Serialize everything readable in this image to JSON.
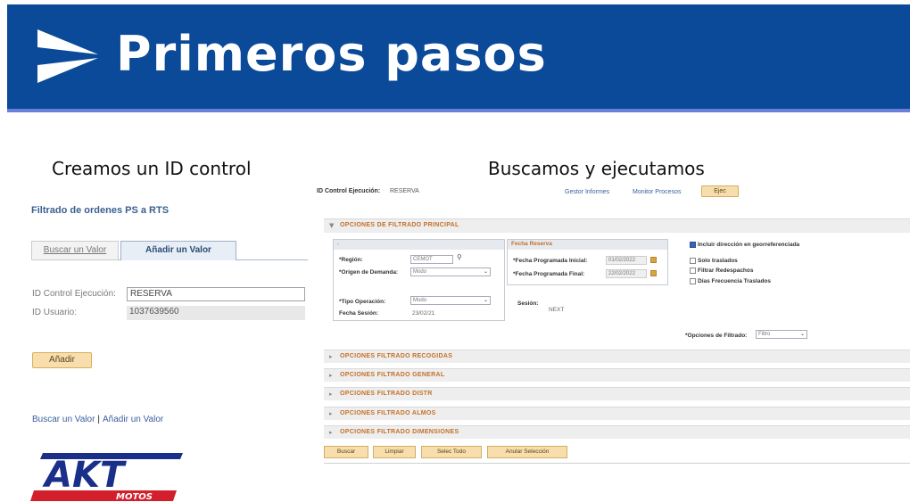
{
  "banner": {
    "title": "Primeros pasos",
    "background": "#0b4a98",
    "icon": "chevron-logo-icon"
  },
  "left_section": {
    "heading": "Creamos un ID control",
    "page_title": "Filtrado de ordenes PS a RTS",
    "tabs": [
      {
        "label": "Buscar un Valor",
        "active": false
      },
      {
        "label": "Añadir un Valor",
        "active": true
      }
    ],
    "fields": {
      "control_label": "ID Control Ejecución:",
      "control_value": "RESERVA",
      "user_label": "ID Usuario:",
      "user_value": "1037639560"
    },
    "add_button": "Añadir",
    "links": {
      "search": "Buscar un Valor",
      "separator": "|",
      "add": "Añadir un Valor"
    },
    "brand_logo": {
      "main": "AKT",
      "sub": "MOTOS"
    }
  },
  "right_section": {
    "heading": "Buscamos y ejecutamos",
    "control_label": "ID Control Ejecución:",
    "control_value": "RESERVA",
    "links": [
      "Gestor Informes",
      "Monitor Procesos"
    ],
    "exec_button": "Ejec",
    "main_panel": {
      "title": "OPCIONES DE FILTRADO PRINCIPAL",
      "box1": {
        "header": "-",
        "region_label": "*Región:",
        "region_value": "CEMOT",
        "demand_label": "*Origen de Demanda:",
        "demand_value": "Modo",
        "op_type_label": "*Tipo Operación:",
        "op_type_value": "Modo",
        "session_date_label": "Fecha Sesión:",
        "session_date_value": "23/02/21"
      },
      "box2": {
        "header": "Fecha Reserva",
        "start_label": "*Fecha Programada Inicial:",
        "start_value": "01/02/2022",
        "end_label": "*Fecha Programada Final:",
        "end_value": "22/02/2022"
      },
      "session_label": "Sesión:",
      "session_value": "NEXT",
      "checkboxes": [
        {
          "label": "Incluir dirección en georreferenciada",
          "checked": true
        },
        {
          "label": "Solo traslados",
          "checked": false
        },
        {
          "label": "Filtrar Redespachos",
          "checked": false
        },
        {
          "label": "Días Frecuencia Traslados",
          "checked": false
        }
      ],
      "filter_options_label": "*Opciones de Filtrado:",
      "filter_options_value": "Filtro"
    },
    "collapsed_sections": [
      "OPCIONES FILTRADO RECOGIDAS",
      "OPCIONES FILTRADO GENERAL",
      "OPCIONES FILTRADO DISTR",
      "OPCIONES FILTRADO ALMOS",
      "OPCIONES FILTRADO DIMENSIONES"
    ],
    "bottom_buttons": [
      "Buscar",
      "Limpiar",
      "Selec Todo",
      "Anular Selección"
    ]
  },
  "colors": {
    "accent_button": "#f7deac",
    "section_header_text": "#c2712a",
    "link": "#3a5fa0"
  }
}
